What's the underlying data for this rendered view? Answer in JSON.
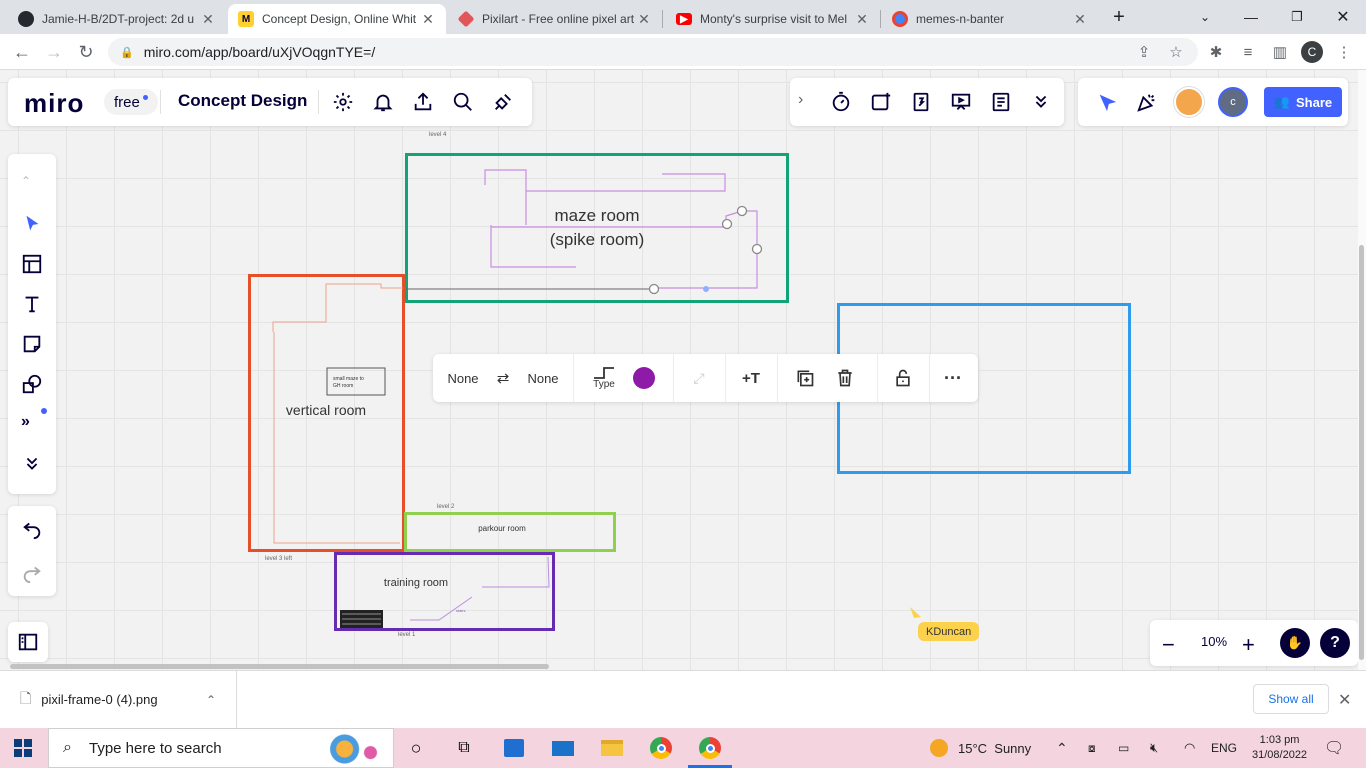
{
  "browser": {
    "tabs": [
      {
        "title": "Jamie-H-B/2DT-project: 2d u",
        "favicon": "github-icon"
      },
      {
        "title": "Concept Design, Online Whit",
        "favicon": "miro-icon"
      },
      {
        "title": "Pixilart - Free online pixel art",
        "favicon": "pixilart-icon"
      },
      {
        "title": "Monty's surprise visit to Mel",
        "favicon": "youtube-icon"
      },
      {
        "title": "memes-n-banter",
        "favicon": "chrome-tab-icon"
      }
    ],
    "url": "miro.com/app/board/uXjVOqgnTYE=/",
    "profile_initial": "C"
  },
  "miro": {
    "logo": "miro",
    "plan": "free",
    "board_title": "Concept Design",
    "share_label": "Share",
    "zoom": "10%",
    "collaborator_initial": "c",
    "cursor_user": "KDuncan",
    "accent_color": "#4262ff"
  },
  "canvas": {
    "frame_labels": {
      "level4": "level 4",
      "level2": "level 2",
      "level3left": "level 3 left",
      "level1": "level 1"
    },
    "maze_room_line1": "maze room",
    "maze_room_line2": "(spike room)",
    "vertical_room": "vertical room",
    "small_maze": "small maze to\nGH room",
    "parkour_room": "parkour room",
    "training_room": "training room",
    "stairs_note": "stairs"
  },
  "context_toolbar": {
    "start_cap": "None",
    "end_cap": "None",
    "type_label": "Type",
    "line_color": "#8e1ba8"
  },
  "downloads": {
    "file": "pixil-frame-0 (4).png",
    "show_all": "Show all"
  },
  "taskbar": {
    "search_placeholder": "Type here to search",
    "weather": "15°C  Sunny",
    "lang": "ENG",
    "time": "1:03 pm",
    "date": "31/08/2022"
  }
}
